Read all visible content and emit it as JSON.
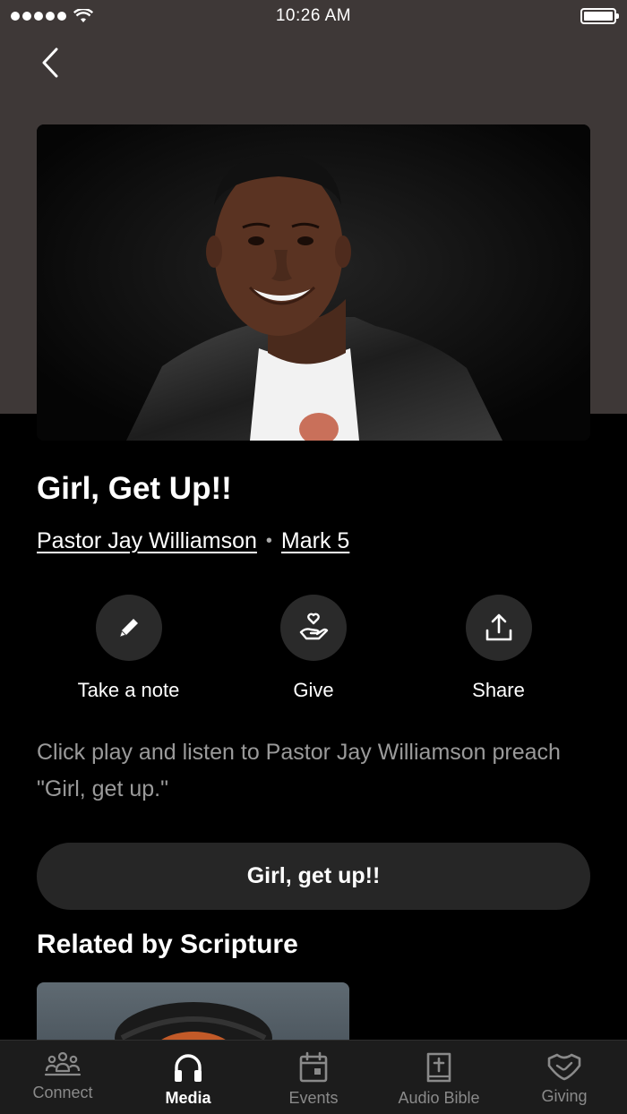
{
  "status_bar": {
    "time": "10:26 AM"
  },
  "sermon": {
    "title": "Girl, Get Up!!",
    "speaker": "Pastor Jay Williamson",
    "scripture": "Mark 5",
    "description": "Click play and listen to Pastor Jay Williamson preach \"Girl, get up.\"",
    "play_label": "Girl, get up!!"
  },
  "actions": {
    "note_label": "Take a note",
    "give_label": "Give",
    "share_label": "Share"
  },
  "related": {
    "heading": "Related by Scripture"
  },
  "tabs": [
    {
      "label": "Connect",
      "icon": "people-icon",
      "active": false
    },
    {
      "label": "Media",
      "icon": "headphones-icon",
      "active": true
    },
    {
      "label": "Events",
      "icon": "calendar-icon",
      "active": false
    },
    {
      "label": "Audio Bible",
      "icon": "bible-icon",
      "active": false
    },
    {
      "label": "Giving",
      "icon": "giving-icon",
      "active": false
    }
  ]
}
